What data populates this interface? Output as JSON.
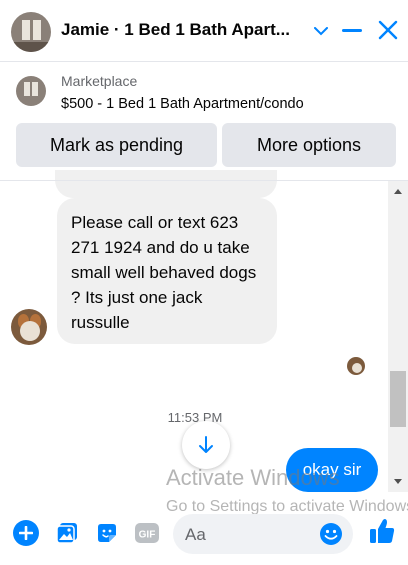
{
  "header": {
    "title": "Jamie · 1 Bed 1 Bath Apart..."
  },
  "marketplace": {
    "label": "Marketplace",
    "listing": "$500 - 1 Bed 1 Bath Apartment/condo",
    "mark_pending_label": "Mark as pending",
    "more_options_label": "More options"
  },
  "messages": [
    {
      "from": "Jamie",
      "text": "Please call or text 623 271 1924 and do u take small well behaved dogs ? Its just one jack russulle"
    },
    {
      "from": "me",
      "text": "okay sir"
    }
  ],
  "timestamp": "11:53 PM",
  "composer": {
    "placeholder": "Aa"
  },
  "watermark": {
    "line1": "Activate Windows",
    "line2": "Go to Settings to activate Windows."
  },
  "colors": {
    "accent": "#0084ff",
    "bubble_incoming": "#f0f0f0",
    "button_bg": "#e4e6eb"
  },
  "icons": [
    "chevron-down-icon",
    "minimize-icon",
    "close-icon",
    "plus-icon",
    "image-icon",
    "sticker-icon",
    "gif-icon",
    "emoji-icon",
    "thumbs-up-icon",
    "arrow-down-icon"
  ]
}
